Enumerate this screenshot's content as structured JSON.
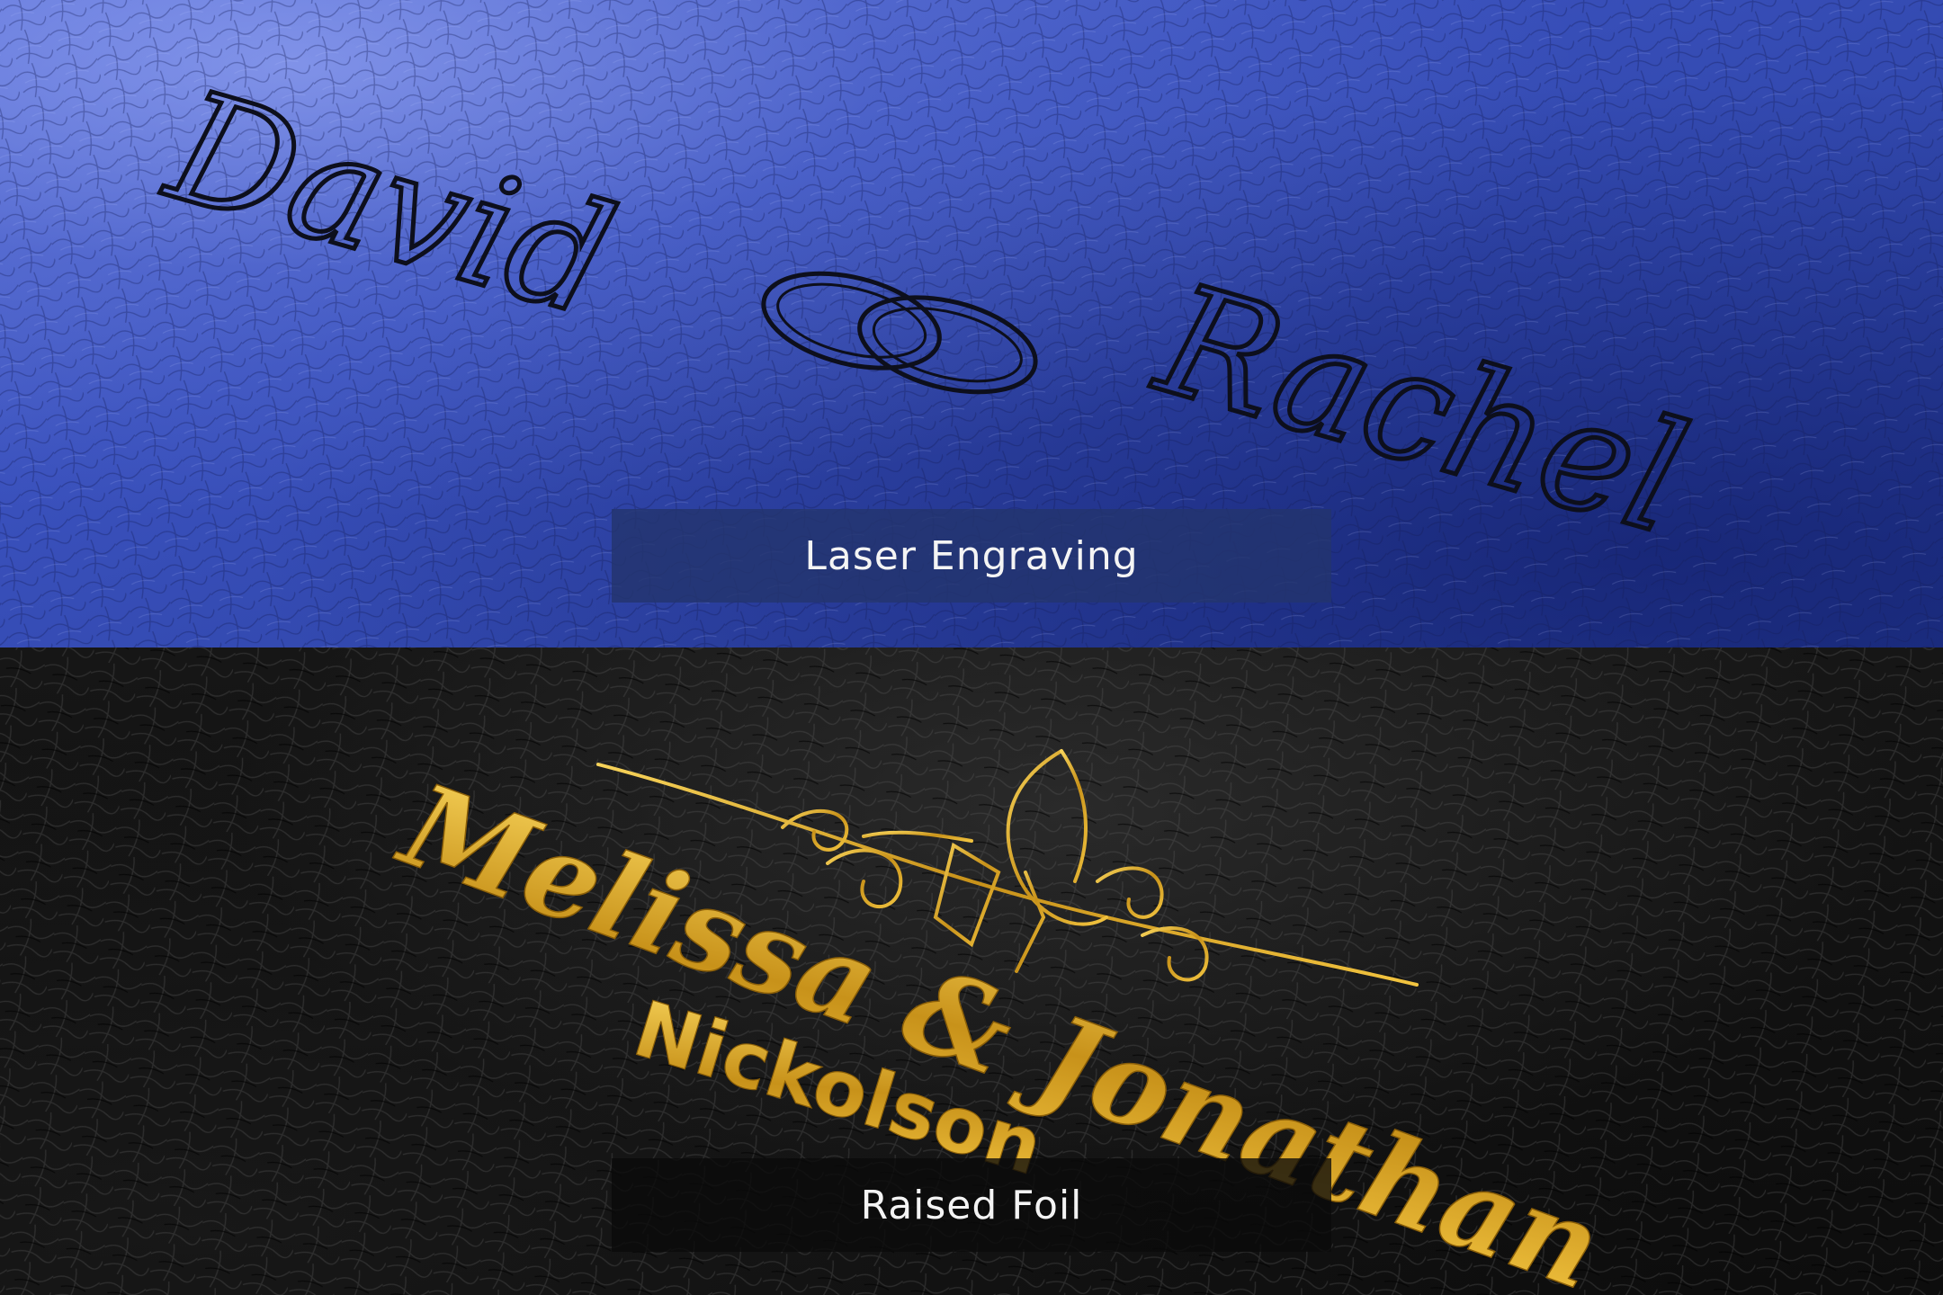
{
  "top_panel": {
    "name_left": "David",
    "name_right": "Rachel",
    "caption": "Laser Engraving",
    "surface_color": "#3a51bd",
    "ink_color": "#0d0f1c"
  },
  "bottom_panel": {
    "names": "Melissa & Jonathan",
    "surname": "Nickolson",
    "caption": "Raised Foil",
    "surface_color": "#111111",
    "foil_color": "#d9a71c"
  }
}
